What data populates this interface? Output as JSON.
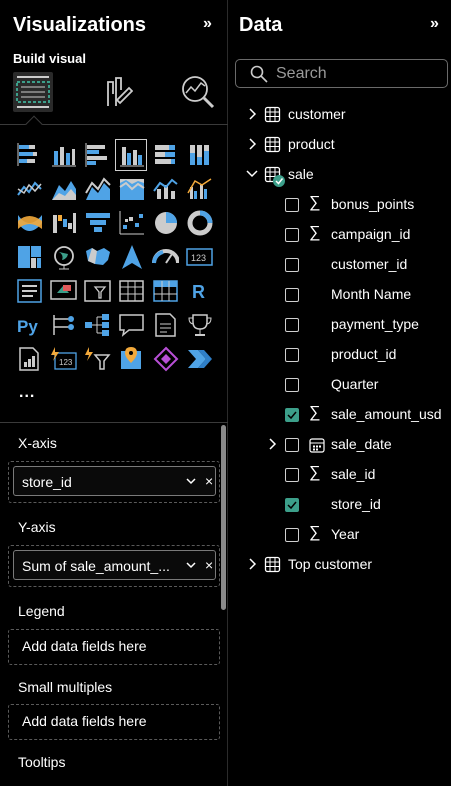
{
  "viz": {
    "title": "Visualizations",
    "build_label": "Build visual",
    "more_label": "...",
    "wells": [
      {
        "label": "X-axis",
        "field": "store_id"
      },
      {
        "label": "Y-axis",
        "field": "Sum of sale_amount_..."
      },
      {
        "label": "Legend",
        "placeholder": "Add data fields here"
      },
      {
        "label": "Small multiples",
        "placeholder": "Add data fields here"
      },
      {
        "label": "Tooltips"
      }
    ],
    "collapse_glyph": "»",
    "remove_glyph": "×"
  },
  "data": {
    "title": "Data",
    "search_placeholder": "Search",
    "tables": [
      {
        "name": "customer"
      },
      {
        "name": "product"
      },
      {
        "name": "sale"
      },
      {
        "name": "Top customer"
      }
    ],
    "fields": [
      {
        "name": "bonus_points",
        "sigma": true,
        "checked": false
      },
      {
        "name": "campaign_id",
        "sigma": true,
        "checked": false
      },
      {
        "name": "customer_id",
        "sigma": false,
        "checked": false
      },
      {
        "name": "Month Name",
        "sigma": false,
        "checked": false
      },
      {
        "name": "payment_type",
        "sigma": false,
        "checked": false
      },
      {
        "name": "product_id",
        "sigma": false,
        "checked": false
      },
      {
        "name": "Quarter",
        "sigma": false,
        "checked": false
      },
      {
        "name": "sale_amount_usd",
        "sigma": true,
        "checked": true
      },
      {
        "name": "sale_date",
        "sigma": false,
        "checked": false,
        "date": true
      },
      {
        "name": "sale_id",
        "sigma": true,
        "checked": false
      },
      {
        "name": "store_id",
        "sigma": false,
        "checked": true
      },
      {
        "name": "Year",
        "sigma": true,
        "checked": false
      }
    ],
    "sigma_glyph": "∑"
  },
  "colors": {
    "accent": "#3c9f8a",
    "blue": "#4fa3e6",
    "orange": "#f2a93b",
    "highlight": "#2a2a2a"
  }
}
